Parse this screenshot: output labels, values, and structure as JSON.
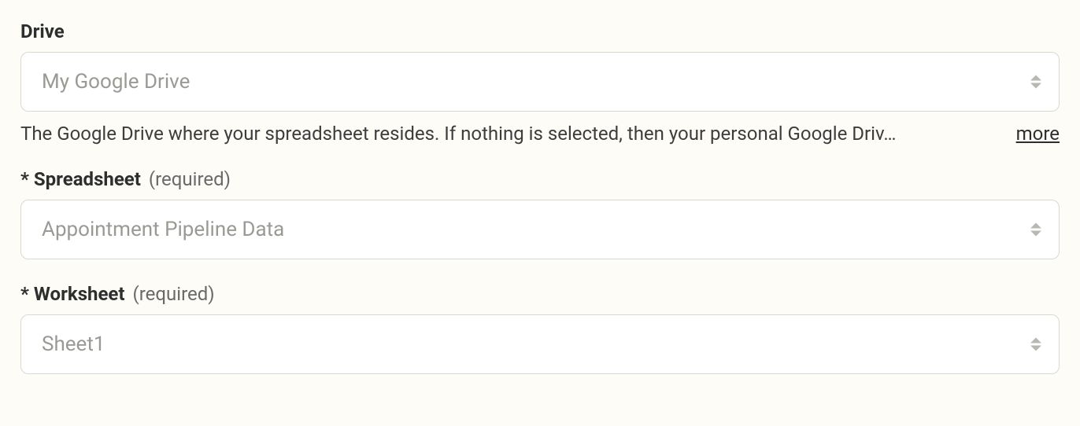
{
  "fields": {
    "drive": {
      "label": "Drive",
      "required": false,
      "value": "My Google Drive",
      "help_text": "The Google Drive where your spreadsheet resides. If nothing is selected, then your personal Google Driv…",
      "more_label": "more"
    },
    "spreadsheet": {
      "label": "Spreadsheet",
      "required": true,
      "required_hint": "(required)",
      "value": "Appointment Pipeline Data"
    },
    "worksheet": {
      "label": "Worksheet",
      "required": true,
      "required_hint": "(required)",
      "value": "Sheet1"
    }
  }
}
